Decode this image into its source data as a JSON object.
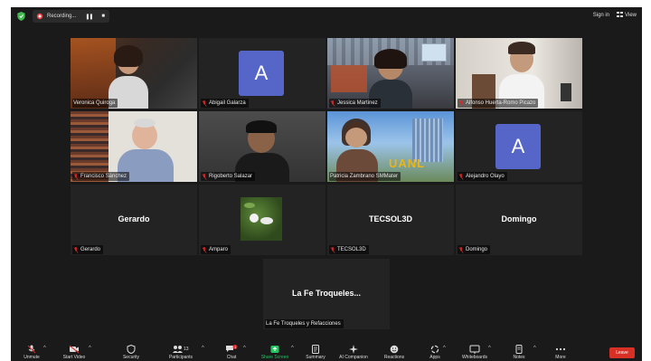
{
  "topbar": {
    "recording": "Recording...",
    "pause": "❚❚",
    "stop": "■",
    "sign_in": "Sign in",
    "view": "View"
  },
  "participants": [
    {
      "name": "Veronica Quiroga",
      "video": true,
      "active": true,
      "muted": false
    },
    {
      "name": "Abigail Galarza",
      "avatar": "A",
      "muted": true
    },
    {
      "name": "Jessica Martinez",
      "video": true,
      "muted": true
    },
    {
      "name": "Alfonso Huerta-Romo Picazo",
      "video": true,
      "muted": true
    },
    {
      "name": "Francisco Sánchez",
      "video": true,
      "muted": true
    },
    {
      "name": "Rigoberto Salazar",
      "video": true,
      "muted": true
    },
    {
      "name": "Patricia Zambrano SMMater",
      "video": true,
      "muted": false,
      "sign": "UANL"
    },
    {
      "name": "Alejandro Olayo",
      "avatar": "A",
      "muted": true
    },
    {
      "name": "Gerardo",
      "display": "Gerardo",
      "muted": true
    },
    {
      "name": "Amparo",
      "video": true,
      "muted": true
    },
    {
      "name": "TECSOL3D",
      "display": "TECSOL3D",
      "muted": true
    },
    {
      "name": "Domingo",
      "display": "Domingo",
      "muted": true
    },
    {
      "name": "La Fe Troqueles y Refacciones",
      "display": "La Fe Troqueles...",
      "muted": false
    }
  ],
  "toolbar": {
    "unmute": "Unmute",
    "start_video": "Start Video",
    "security": "Security",
    "participants": "Participants",
    "participants_count": "13",
    "chat": "Chat",
    "chat_badge": "1",
    "share_screen": "Share Screen",
    "summary": "Summary",
    "ai_companion": "AI Companion",
    "reactions": "Reactions",
    "apps": "Apps",
    "whiteboards": "Whiteboards",
    "notes": "Notes",
    "more": "More",
    "leave": "Leave"
  },
  "colors": {
    "active_border": "#c8dd44",
    "avatar_bg": "#5666c8",
    "mute_red": "#e02828",
    "share_green": "#22c55e",
    "leave_red": "#d93025"
  }
}
